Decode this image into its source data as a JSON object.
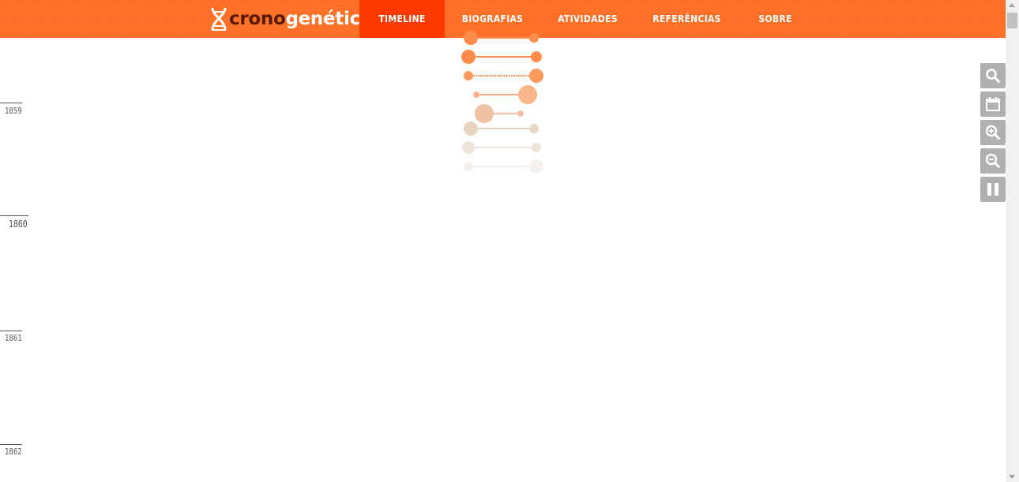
{
  "brand": {
    "prefix": "crono",
    "suffix": "genética",
    "accent": "#ff6a1f",
    "active": "#ff3a00"
  },
  "nav": [
    {
      "label": "TIMELINE",
      "active": true
    },
    {
      "label": "BIOGRAFIAS",
      "active": false
    },
    {
      "label": "ATIVIDADES",
      "active": false
    },
    {
      "label": "REFERÊNCIAS",
      "active": false
    },
    {
      "label": "SOBRE",
      "active": false
    }
  ],
  "timeline": {
    "years": [
      "1859",
      "1860",
      "1861",
      "1862"
    ]
  },
  "tools": [
    {
      "icon": "search-icon"
    },
    {
      "icon": "calendar-icon"
    },
    {
      "icon": "zoom-in-icon"
    },
    {
      "icon": "zoom-out-icon"
    },
    {
      "icon": "pause-icon"
    }
  ],
  "loader": {
    "icon": "dna-loading-icon"
  }
}
